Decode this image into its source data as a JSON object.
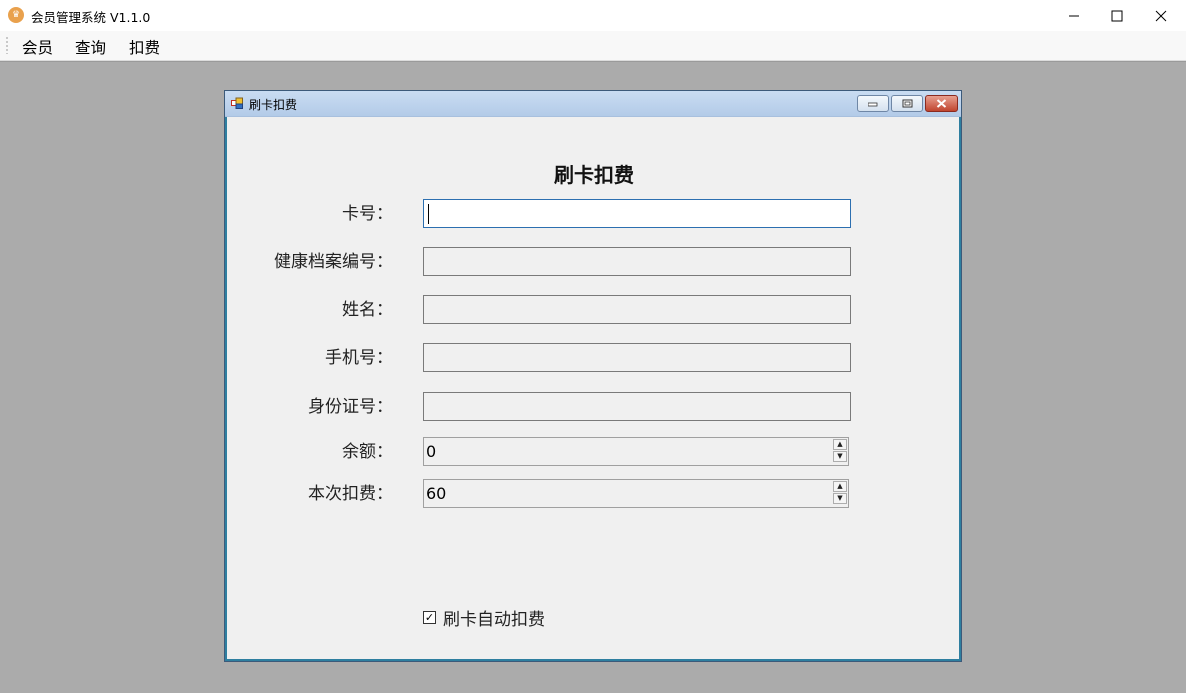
{
  "window": {
    "title": "会员管理系统 V1.1.0",
    "icon": "crown-icon"
  },
  "menu": {
    "items": [
      {
        "label": "会员"
      },
      {
        "label": "查询"
      },
      {
        "label": "扣费"
      }
    ]
  },
  "child_window": {
    "title": "刷卡扣费",
    "icon": "app-window-icon"
  },
  "form": {
    "heading": "刷卡扣费",
    "fields": [
      {
        "label": "卡号：",
        "value": ""
      },
      {
        "label": "健康档案编号：",
        "value": ""
      },
      {
        "label": "姓名：",
        "value": ""
      },
      {
        "label": "手机号：",
        "value": ""
      },
      {
        "label": "身份证号：",
        "value": ""
      }
    ],
    "balance": {
      "label": "余额：",
      "value": "0"
    },
    "charge": {
      "label": "本次扣费：",
      "value": "60"
    },
    "auto_charge": {
      "label": "刷卡自动扣费",
      "checked": true
    }
  },
  "colors": {
    "mdi_background": "#ababab",
    "child_title_gradient": "#c9dcf2",
    "close_button": "#c0452f"
  }
}
